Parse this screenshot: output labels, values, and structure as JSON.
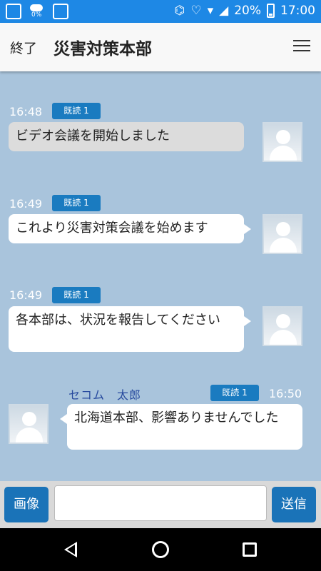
{
  "status_bar": {
    "cloud_percent": "0%",
    "battery_text": "20%",
    "time": "17:00"
  },
  "header": {
    "end_label": "終了",
    "title": "災害対策本部"
  },
  "messages": [
    {
      "time": "16:48",
      "read": "既読 1",
      "text": "ビデオ会議を開始しました"
    },
    {
      "time": "16:49",
      "read": "既読 1",
      "text": "これより災害対策会議を始めます"
    },
    {
      "time": "16:49",
      "read": "既読 1",
      "text": "各本部は、状況を報告してください"
    },
    {
      "sender": "セコム　太郎",
      "time": "16:50",
      "read": "既読 1",
      "text": "北海道本部、影響ありませんでした"
    }
  ],
  "input_bar": {
    "image_label": "画像",
    "message_value": "",
    "send_label": "送信"
  }
}
